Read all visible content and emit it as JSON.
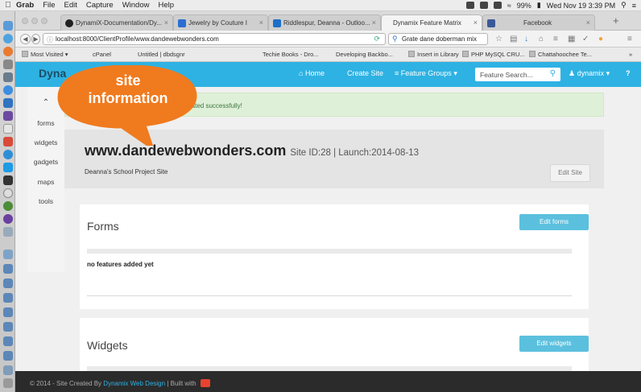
{
  "menubar": {
    "app": "Grab",
    "items": [
      "File",
      "Edit",
      "Capture",
      "Window",
      "Help"
    ],
    "battery": "99%",
    "clock": "Wed Nov 19  3:39 PM"
  },
  "tabs": [
    {
      "label": "DynamiX-Documentation/Dy...",
      "active": false
    },
    {
      "label": "Jewelry by Couture I",
      "active": false
    },
    {
      "label": "Riddlespur, Deanna - Outloo...",
      "active": false
    },
    {
      "label": "Dynamix Feature Matrix",
      "active": true
    },
    {
      "label": "Facebook",
      "active": false
    }
  ],
  "toolbar": {
    "url": "localhost:8000/ClientProfile/www.dandewebwonders.com",
    "search_value": "Grate dane doberman mix"
  },
  "bookmarks": [
    "Most Visited",
    "cPanel",
    "Untitled | dbdsgnr",
    "Techie Books - Dro...",
    "Developing Backbo...",
    "Insert in Library",
    "PHP MySQL CRU...",
    "Chattahoochee Te..."
  ],
  "site_nav": {
    "logo": "Dyna",
    "home": "Home",
    "create": "Create Site",
    "groups": "Feature Groups",
    "search_placeholder": "Feature Search...",
    "user": "dynamix"
  },
  "sidebar": {
    "items": [
      "forms",
      "widgets",
      "gadgets",
      "maps",
      "tools"
    ]
  },
  "alert": {
    "text": "com updated successfully!"
  },
  "site": {
    "url": "www.dandewebwonders.com",
    "meta": "Site ID:28 | Launch:2014-08-13",
    "description": "Deanna's School Project Site",
    "edit_label": "Edit Site"
  },
  "sections": [
    {
      "title": "Forms",
      "button": "Edit forms",
      "empty": "no features added yet"
    },
    {
      "title": "Widgets",
      "button": "Edit widgets"
    }
  ],
  "footer": {
    "prefix": "© 2014 - Site Created By",
    "link": "Dynamix Web Design",
    "suffix": "| Built with"
  },
  "annotation": {
    "line1": "site",
    "line2": "information",
    "color": "#f07a1e"
  },
  "colors": {
    "accent": "#2eb2e3",
    "button": "#5bc0de",
    "success_bg": "#dff0d8"
  }
}
